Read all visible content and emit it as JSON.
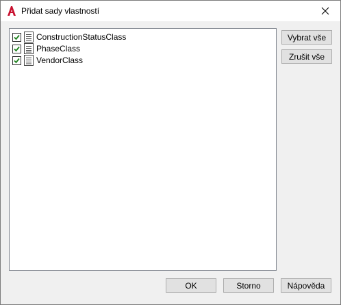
{
  "window": {
    "title": "Přidat sady vlastností"
  },
  "list": {
    "items": [
      {
        "label": "ConstructionStatusClass",
        "checked": true
      },
      {
        "label": "PhaseClass",
        "checked": true
      },
      {
        "label": "VendorClass",
        "checked": true
      }
    ]
  },
  "side_buttons": {
    "select_all": "Vybrat vše",
    "clear_all": "Zrušit vše"
  },
  "footer_buttons": {
    "ok": "OK",
    "cancel": "Storno",
    "help": "Nápověda"
  },
  "colors": {
    "checkmark": "#1a7f1a",
    "app_icon": "#c8102e"
  }
}
